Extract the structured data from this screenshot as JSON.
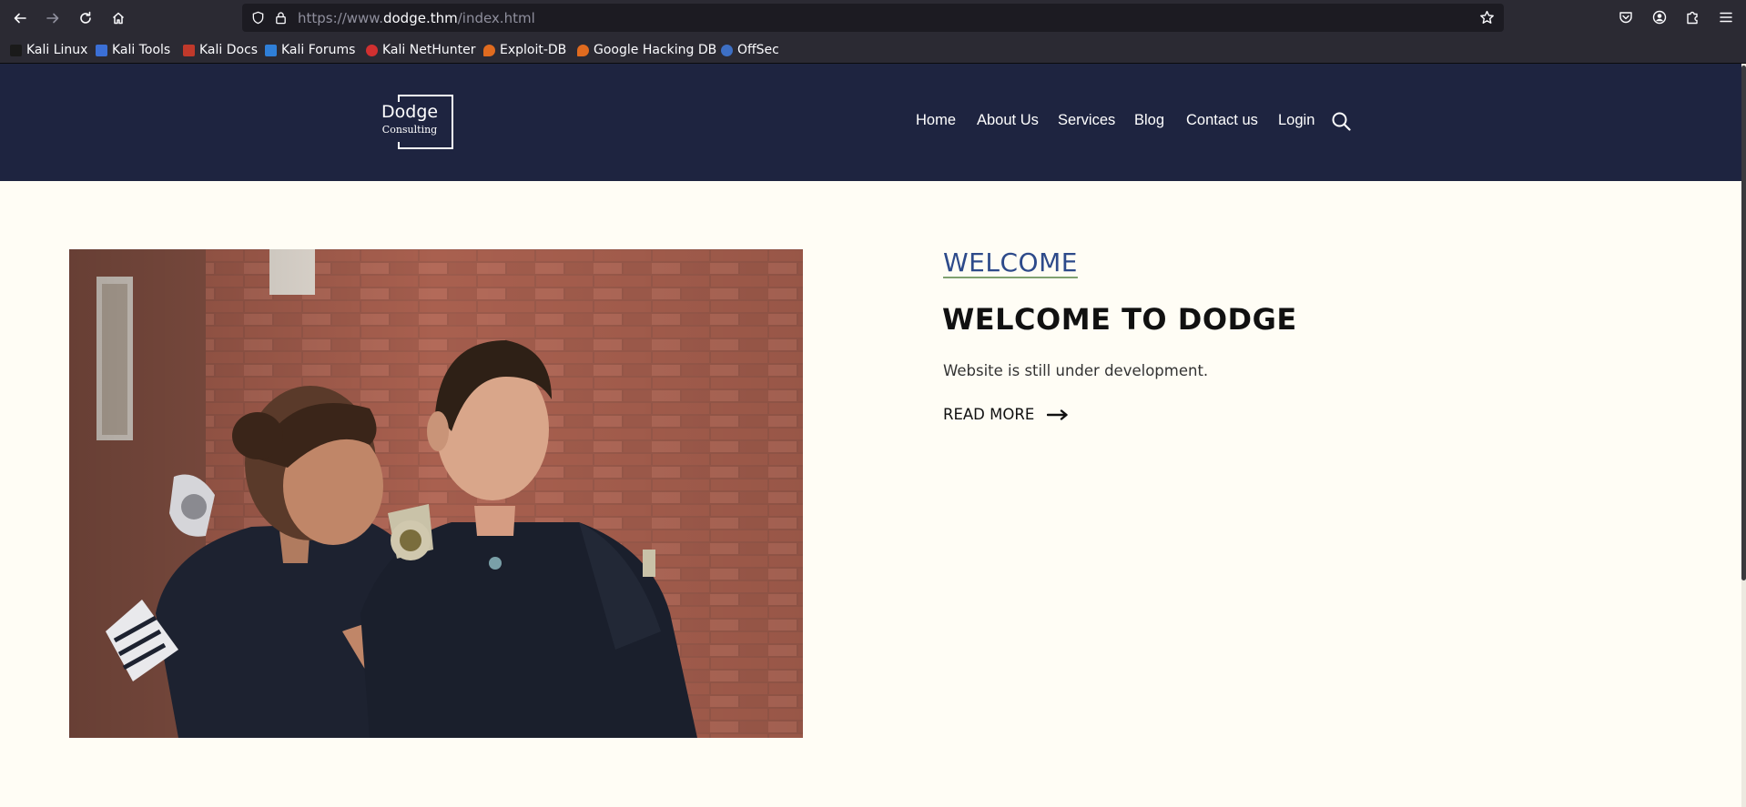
{
  "browser": {
    "url_prefix": "https://www.",
    "url_domain": "dodge.thm",
    "url_suffix": "/index.html",
    "icons": {
      "back": "arrow-left-icon",
      "forward": "arrow-right-icon",
      "reload": "reload-icon",
      "home": "home-icon",
      "tracking": "shield-icon",
      "security": "lock-icon",
      "bookmark": "star-icon",
      "pocket": "pocket-icon",
      "account": "account-icon",
      "extensions": "puzzle-icon",
      "menu": "hamburger-icon"
    }
  },
  "bookmarks": [
    {
      "label": "Kali Linux",
      "icon": "kali-dragon-icon",
      "color": "#1a1a1a"
    },
    {
      "label": "Kali Tools",
      "icon": "kali-tools-icon",
      "color": "#3b6fd6"
    },
    {
      "label": "Kali Docs",
      "icon": "kali-docs-icon",
      "color": "#c0392b"
    },
    {
      "label": "Kali Forums",
      "icon": "kali-forums-icon",
      "color": "#2f7fd8"
    },
    {
      "label": "Kali NetHunter",
      "icon": "nethunter-icon",
      "color": "#d13030"
    },
    {
      "label": "Exploit-DB",
      "icon": "exploit-db-icon",
      "color": "#e06b1f"
    },
    {
      "label": "Google Hacking DB",
      "icon": "ghdb-icon",
      "color": "#e06b1f"
    },
    {
      "label": "OffSec",
      "icon": "offsec-icon",
      "color": "#3d6fc4"
    }
  ],
  "site": {
    "logo_line1": "Dodge",
    "logo_line2": "Consulting",
    "nav": [
      "Home",
      "About Us",
      "Services",
      "Blog",
      "Contact us",
      "Login"
    ],
    "search_icon": "search-icon",
    "colors": {
      "header_bg": "#1e2440",
      "page_bg": "#fffdf5",
      "welcome_link": "#2d4a8a"
    }
  },
  "hero": {
    "eyebrow": "WELCOME",
    "title": "WELCOME TO DODGE",
    "text": "Website is still under development.",
    "cta": "READ MORE",
    "cta_icon": "long-arrow-right-icon",
    "image": "two-police-officers-looking-at-phone-photo"
  }
}
